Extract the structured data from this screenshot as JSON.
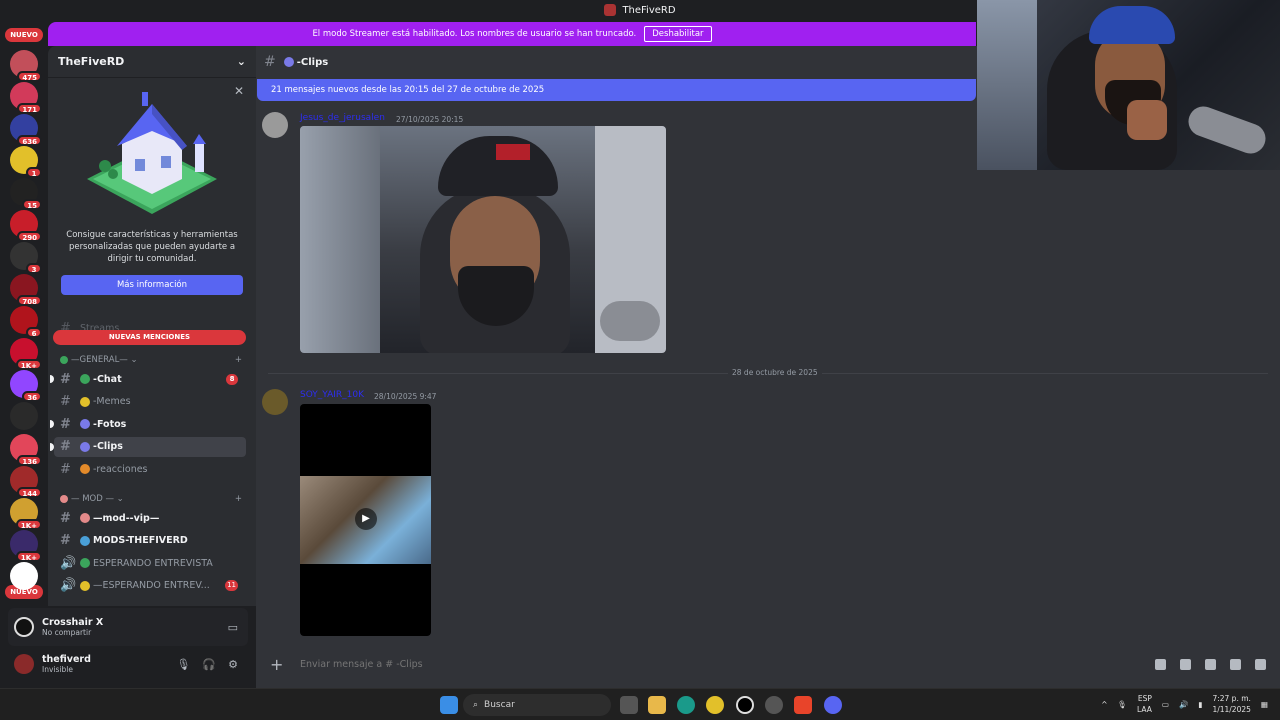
{
  "window": {
    "title": "TheFiveRD"
  },
  "streamer_mode": {
    "message": "El modo Streamer está habilitado. Los nombres de usuario se han truncado.",
    "button": "Deshabilitar"
  },
  "rail": {
    "new_top": "NUEVO",
    "new_bottom": "NUEVO",
    "servers": [
      {
        "badge": "475",
        "color": "#c24f5a"
      },
      {
        "badge": "171",
        "color": "#d23a5a"
      },
      {
        "badge": "636",
        "color": "#3340a0"
      },
      {
        "badge": "1",
        "color": "#e2c02a"
      },
      {
        "badge": "15",
        "color": "#222222"
      },
      {
        "badge": "290",
        "color": "#c81e2a"
      },
      {
        "badge": "3",
        "color": "#333333"
      },
      {
        "badge": "708",
        "color": "#8a1620"
      },
      {
        "badge": "6",
        "color": "#b0141c"
      },
      {
        "badge": "1K+",
        "color": "#c8102e"
      },
      {
        "badge": "36",
        "color": "#9146ff"
      },
      {
        "badge": "",
        "color": "#2a2a2a"
      },
      {
        "badge": "136",
        "color": "#e2465a"
      },
      {
        "badge": "144",
        "color": "#a02a2a"
      },
      {
        "badge": "1K+",
        "color": "#d0a030"
      },
      {
        "badge": "1K+",
        "color": "#3a2a6a"
      },
      {
        "badge": "",
        "color": "#ffffff"
      }
    ]
  },
  "sidebar": {
    "server_name": "TheFiveRD",
    "promo_text": "Consigue características y herramientas personalizadas que pueden ayudarte a dirigir tu comunidad.",
    "promo_button": "Más información",
    "hidden_channel": "Streams",
    "new_mentions": "NUEVAS MENCIONES",
    "category_general": "—GENERAL—",
    "channels_general": [
      {
        "name": "-Chat",
        "count": "8"
      },
      {
        "name": "-Memes",
        "count": ""
      },
      {
        "name": "-Fotos",
        "count": ""
      },
      {
        "name": "-Clips",
        "count": ""
      },
      {
        "name": "-reacciones",
        "count": ""
      }
    ],
    "category_mod": "— MOD —",
    "channels_mod": [
      {
        "name": "—mod--vip—",
        "count": ""
      },
      {
        "name": "MODS-THEFIVERD",
        "count": ""
      }
    ],
    "voice": [
      {
        "name": "ESPERANDO ENTREVISTA",
        "count": ""
      },
      {
        "name": "—ESPERANDO ENTREV...",
        "count": "11"
      }
    ]
  },
  "activity": {
    "title": "Crosshair X",
    "status": "No compartir"
  },
  "user": {
    "name": "thefiverd",
    "status": "Invisible"
  },
  "channel": {
    "name": "-Clips"
  },
  "new_messages_banner": "21 mensajes nuevos desde las 20:15 del 27 de octubre de 2025",
  "messages": [
    {
      "author": "Jesus_de_jerusalen",
      "time": "27/10/2025 20:15"
    },
    {
      "author": "SOY_YAIR_10K",
      "time": "28/10/2025 9:47"
    }
  ],
  "date_divider": "28 de octubre de 2025",
  "composer": {
    "placeholder": "Enviar mensaje a # -Clips"
  },
  "taskbar": {
    "search": "Buscar",
    "lang_top": "ESP",
    "lang_bottom": "LAA",
    "time": "7:27 p. m.",
    "date": "1/11/2025"
  }
}
